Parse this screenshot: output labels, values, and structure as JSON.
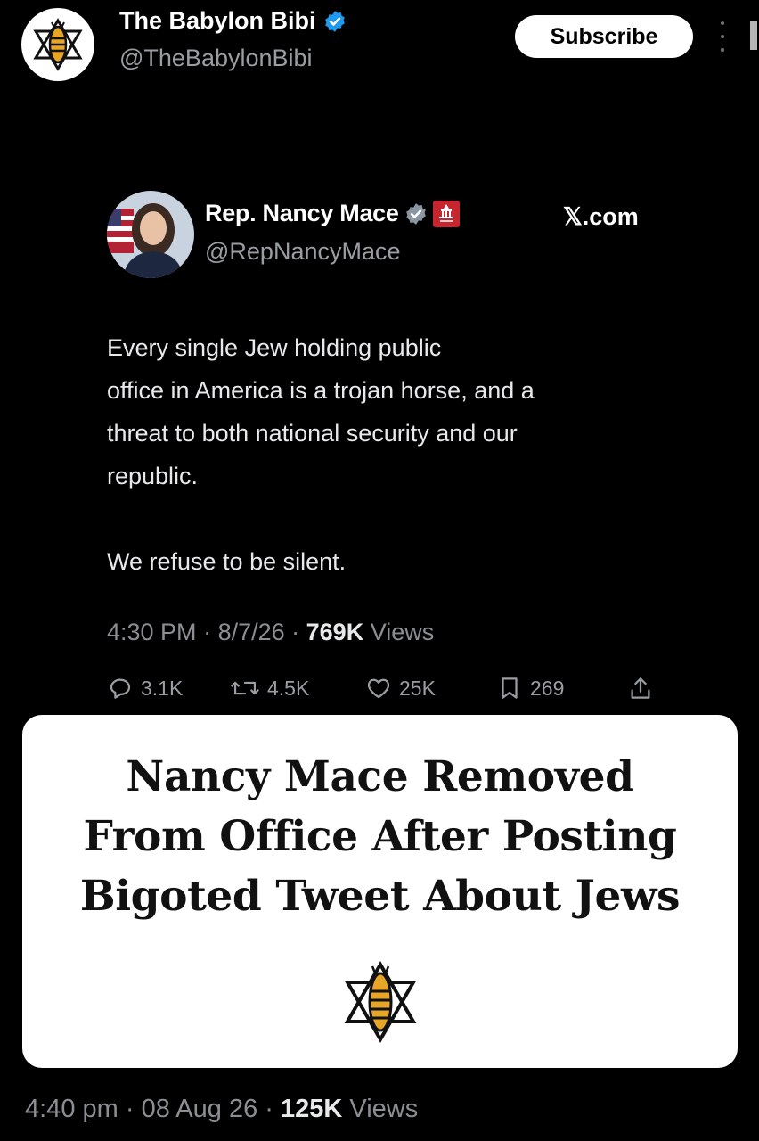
{
  "post": {
    "author_name": "The Babylon Bibi",
    "author_handle": "@TheBabylonBibi",
    "subscribe_label": "Subscribe",
    "footer": {
      "time": "4:40 pm",
      "date": "08 Aug 26",
      "views_count": "125K",
      "views_label": "Views"
    }
  },
  "embedded_tweet": {
    "name": "Rep. Nancy Mace",
    "handle": "@RepNancyMace",
    "source": "𝕏.com",
    "body": "Every single Jew holding public\noffice in America is a trojan horse, and a\nthreat to both national security and our\nrepublic.\n\nWe refuse to be silent.",
    "time": "4:30 PM",
    "date": "8/7/26",
    "views_count": "769K",
    "views_label": "Views",
    "replies": "3.1K",
    "reposts": "4.5K",
    "likes": "25K",
    "bookmarks": "269"
  },
  "headline_card": {
    "headline": "Nancy Mace Removed\nFrom Office After Posting\nBigoted Tweet About Jews"
  },
  "colors": {
    "background": "#000000",
    "verified_blue": "#1d9bf0",
    "logo_gold": "#e8a628",
    "muted_text": "#8b8f93"
  }
}
